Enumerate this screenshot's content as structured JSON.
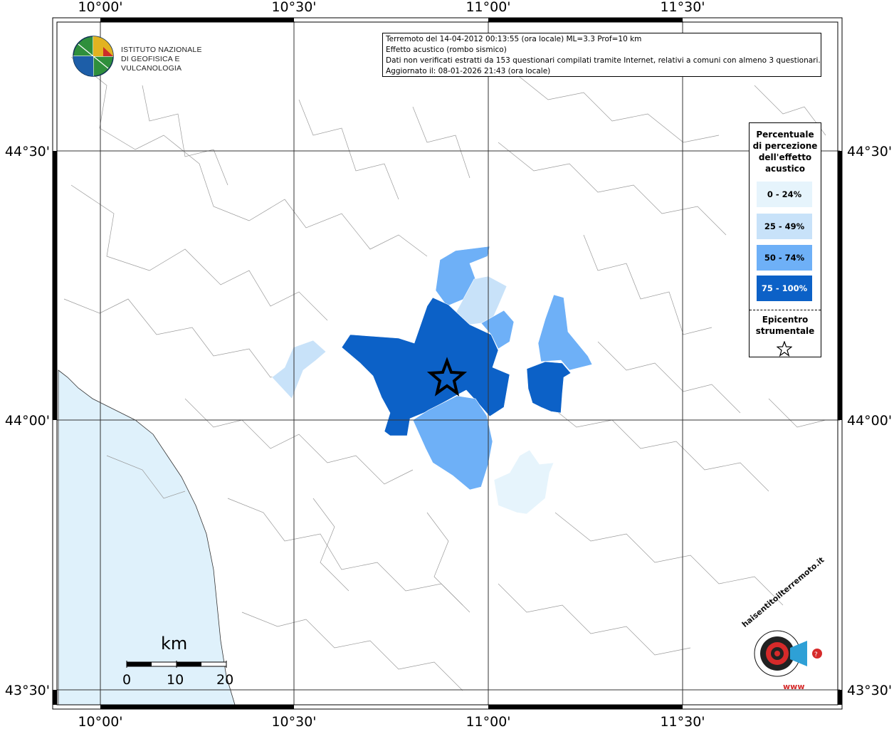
{
  "map": {
    "top_ticks": [
      "10°00'",
      "10°30'",
      "11°00'",
      "11°30'"
    ],
    "bottom_ticks": [
      "10°00'",
      "10°30'",
      "11°00'",
      "11°30'"
    ],
    "left_ticks": [
      "44°30'",
      "44°00'",
      "43°30'"
    ],
    "right_ticks": [
      "44°30'",
      "44°00'",
      "43°30'"
    ],
    "colors": {
      "sea": "#dff1fb",
      "class_0_24": "#e6f4fc",
      "class_25_49": "#c8e2f9",
      "class_50_74": "#6eb0f7",
      "class_75_100": "#0c61c7"
    }
  },
  "info": {
    "line1": "Terremoto del 14-04-2012 00:13:55 (ora locale) ML=3.3 Prof=10 km",
    "line2": "Effetto acustico (rombo sismico)",
    "line3": "Dati non verificati estratti da 153 questionari compilati tramite Internet, relativi a comuni con almeno 3 questionari.",
    "line4": "Aggiornato il: 08-01-2026 21:43 (ora locale)"
  },
  "logo": {
    "line1": "ISTITUTO NAZIONALE",
    "line2": "DI GEOFISICA E VULCANOLOGIA"
  },
  "legend": {
    "title1": "Percentuale",
    "title2": "di percezione",
    "title3": "dell'effetto",
    "title4": "acustico",
    "class1": "0 - 24%",
    "class2": "25 - 49%",
    "class3": "50 - 74%",
    "class4": "75 - 100%",
    "epi1": "Epicentro",
    "epi2": "strumentale"
  },
  "scale": {
    "unit": "km",
    "labels": [
      "0",
      "10",
      "20"
    ]
  },
  "hsl_logo": {
    "text": "haisentitoilterremoto.it",
    "url": "www"
  }
}
